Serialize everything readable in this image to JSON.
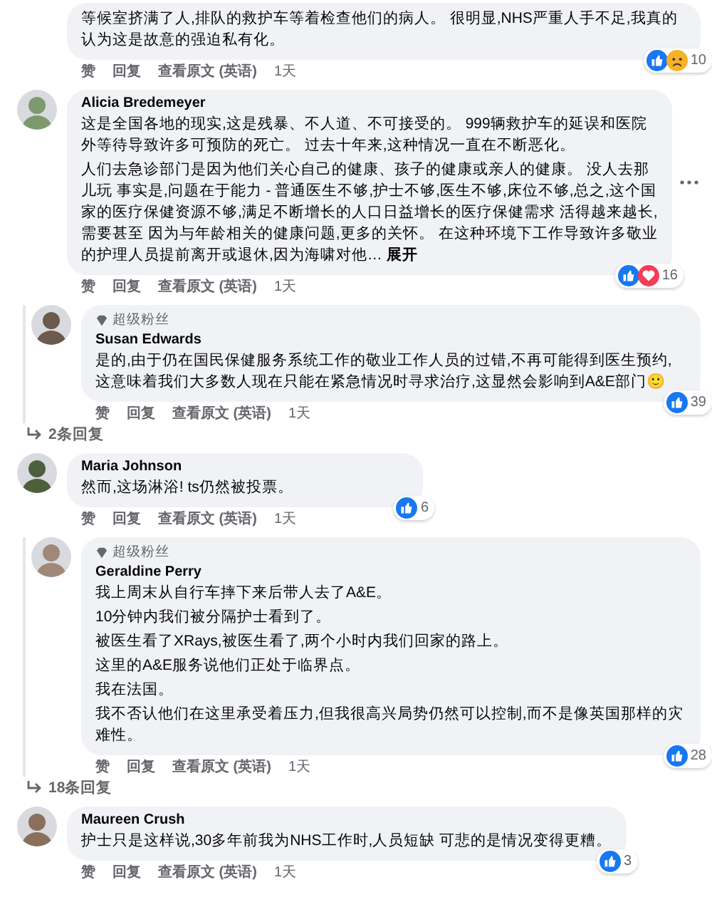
{
  "comments": [
    {
      "kind": "comment",
      "paragraphs": [
        "等候室挤满了人,排队的救护车等着检查他们的病人。 很明显,NHS严重人手不足,我真的认为这是故意的强迫私有化。"
      ],
      "reactions": {
        "icons": [
          {
            "kind": "like"
          },
          {
            "kind": "sad"
          }
        ],
        "count": "10"
      },
      "actions": [
        "赞",
        "回复",
        "查看原文 (英语)",
        "1天"
      ]
    },
    {
      "kind": "comment",
      "author": "Alicia Bredemeyer",
      "more": true,
      "paragraphs": [
        "这是全国各地的现实,这是残暴、不人道、不可接受的。 999辆救护车的延误和医院外等待导致许多可预防的死亡。 过去十年来,这种情况一直在不断恶化。",
        "人们去急诊部门是因为他们关心自己的健康、孩子的健康或亲人的健康。 没人去那儿玩 事实是,问题在于能力 - 普通医生不够,护士不够,医生不够,床位不够,总之,这个国家的医疗保健资源不够,满足不断增长的人口日益增长的医疗保健需求 活得越来越长,需要甚至 因为与年龄相关的健康问题,更多的关怀。 在这种环境下工作导致许多敬业的护理人员提前离开或退休,因为海啸对他…"
      ],
      "expand": "展开",
      "reactions": {
        "icons": [
          {
            "kind": "like"
          },
          {
            "kind": "love"
          }
        ],
        "count": "16"
      },
      "actions": [
        "赞",
        "回复",
        "查看原文 (英语)",
        "1天"
      ]
    },
    {
      "kind": "reply",
      "badge": "超级粉丝",
      "author": "Susan Edwards",
      "paragraphs": [
        "是的,由于仍在国民保健服务系统工作的敬业工作人员的过错,不再可能得到医生预约,这意味着我们大多数人现在只能在紧急情况时寻求治疗,这显然会影响到A&E部门🙂"
      ],
      "reactions": {
        "icons": [
          {
            "kind": "like"
          }
        ],
        "count": "39"
      },
      "actions": [
        "赞",
        "回复",
        "查看原文 (英语)",
        "1天"
      ],
      "replies_link": "2条回复"
    },
    {
      "kind": "comment",
      "author": "Maria Johnson",
      "paragraphs": [
        "然而,这场淋浴! ts仍然被投票。"
      ],
      "reactions": {
        "icons": [
          {
            "kind": "like"
          }
        ],
        "count": "6"
      },
      "actions": [
        "赞",
        "回复",
        "查看原文 (英语)",
        "1天"
      ]
    },
    {
      "kind": "reply",
      "badge": "超级粉丝",
      "author": "Geraldine Perry",
      "paragraphs": [
        "我上周末从自行车摔下来后带人去了A&E。",
        "10分钟内我们被分隔护士看到了。",
        "被医生看了XRays,被医生看了,两个小时内我们回家的路上。",
        "这里的A&E服务说他们正处于临界点。",
        "我在法国。",
        "我不否认他们在这里承受着压力,但我很高兴局势仍然可以控制,而不是像英国那样的灾难性。"
      ],
      "reactions": {
        "icons": [
          {
            "kind": "like"
          }
        ],
        "count": "28"
      },
      "actions": [
        "赞",
        "回复",
        "查看原文 (英语)",
        "1天"
      ],
      "replies_link": "18条回复"
    },
    {
      "kind": "comment",
      "author": "Maureen Crush",
      "paragraphs": [
        "护士只是这样说,30多年前我为NHS工作时,人员短缺 可悲的是情况变得更糟。"
      ],
      "reactions": {
        "icons": [
          {
            "kind": "like"
          }
        ],
        "count": "3"
      },
      "actions": [
        "赞",
        "回复",
        "查看原文 (英语)",
        "1天"
      ]
    }
  ]
}
